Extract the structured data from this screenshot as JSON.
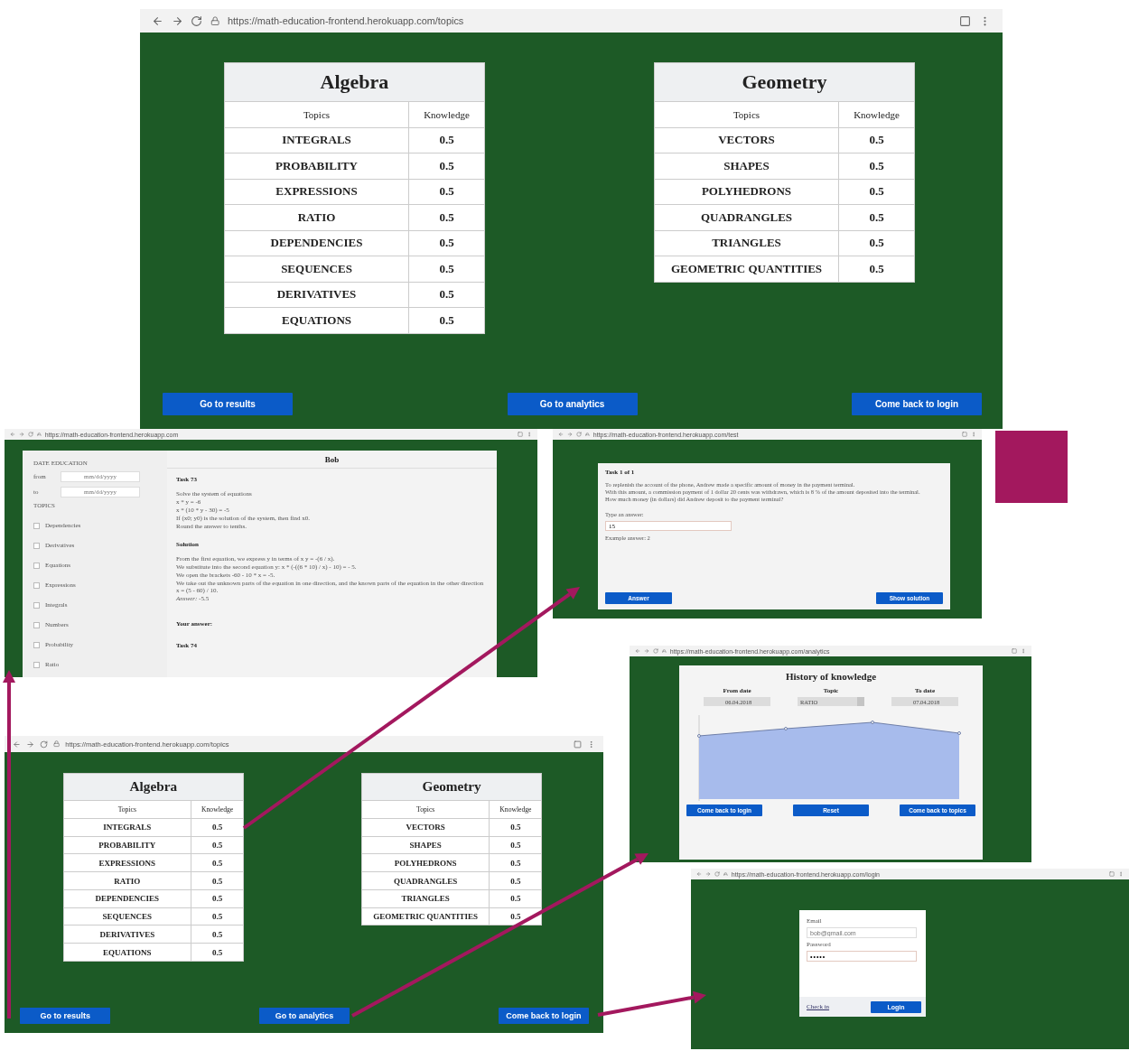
{
  "topics_page": {
    "url": "https://math-education-frontend.herokuapp.com/topics",
    "tables": [
      {
        "title": "Algebra",
        "columns": [
          "Topics",
          "Knowledge"
        ],
        "rows": [
          [
            "INTEGRALS",
            "0.5"
          ],
          [
            "PROBABILITY",
            "0.5"
          ],
          [
            "EXPRESSIONS",
            "0.5"
          ],
          [
            "RATIO",
            "0.5"
          ],
          [
            "DEPENDENCIES",
            "0.5"
          ],
          [
            "SEQUENCES",
            "0.5"
          ],
          [
            "DERIVATIVES",
            "0.5"
          ],
          [
            "EQUATIONS",
            "0.5"
          ]
        ]
      },
      {
        "title": "Geometry",
        "columns": [
          "Topics",
          "Knowledge"
        ],
        "rows": [
          [
            "VECTORS",
            "0.5"
          ],
          [
            "SHAPES",
            "0.5"
          ],
          [
            "POLYHEDRONS",
            "0.5"
          ],
          [
            "QUADRANGLES",
            "0.5"
          ],
          [
            "TRIANGLES",
            "0.5"
          ],
          [
            "GEOMETRIC QUANTITIES",
            "0.5"
          ]
        ]
      }
    ],
    "buttons": [
      "Go to results",
      "Go to analytics",
      "Come back to login"
    ]
  },
  "results_page": {
    "url": "https://math-education-frontend.herokuapp.com",
    "date_heading": "DATE EDUCATION",
    "date_fields": [
      {
        "label": "from",
        "placeholder": "mm/dd/yyyy"
      },
      {
        "label": "to",
        "placeholder": "mm/dd/yyyy"
      }
    ],
    "topics_heading": "TOPICS",
    "topics": [
      {
        "label": "Dependencies",
        "checked": false
      },
      {
        "label": "Derivatives",
        "checked": false
      },
      {
        "label": "Equations",
        "checked": false
      },
      {
        "label": "Expressions",
        "checked": false
      },
      {
        "label": "Integrals",
        "checked": false
      },
      {
        "label": "Numbers",
        "checked": false
      },
      {
        "label": "Probability",
        "checked": false
      },
      {
        "label": "Ratio",
        "checked": false
      }
    ],
    "user": "Bob",
    "task_title": "Task 73",
    "task_lines": [
      "Solve the system of equations",
      "x * y = -6",
      "x * (10 * y - 30) = -5",
      "If (x0; y0) is the solution of the system, then find x0.",
      "Round the answer to tenths."
    ],
    "solution_heading": "Solution",
    "solution_lines": [
      "From the first equation, we express y in terms of x y = -(6 / x).",
      "We substitute into the second equation y: x * (-((6 * 10) / x) - 10) = - 5.",
      "We open the brackets -60 - 10 * x = -5.",
      "We take out the unknown parts of the equation in one direction, and the known parts of the equation in the other direction x = (5 - 60) / 10.",
      "*Answer:* -5.5"
    ],
    "your_answer": "Your answer:",
    "next_task": "Task 74"
  },
  "task_page": {
    "url": "https://math-education-frontend.herokuapp.com/test",
    "title": "Task 1 of 1",
    "lines": [
      "To replenish the account of the phone, Andrew made a specific amount of money in the payment terminal.",
      "With this amount, a commission payment of 1 dollar 20 cents was withdrawn, which is 8 % of the amount deposited into the terminal.",
      "How much money (in dollars) did Andrew deposit to the payment terminal?"
    ],
    "answer_label": "Type an answer:",
    "answer_value": "15",
    "example": "Example answer: 2",
    "buttons": [
      "Answer",
      "Show solution"
    ]
  },
  "analytics_page": {
    "url": "https://math-education-frontend.herokuapp.com/analytics",
    "title": "History of knowledge",
    "filters": [
      {
        "label": "From date",
        "value": "06.04.2018",
        "kind": "date"
      },
      {
        "label": "Topic",
        "value": "RATIO",
        "kind": "select"
      },
      {
        "label": "To date",
        "value": "07.04.2018",
        "kind": "date"
      }
    ],
    "buttons": [
      "Come back to login",
      "Reset",
      "Come back to topics"
    ]
  },
  "topics_page_small": {
    "url": "https://math-education-frontend.herokuapp.com/topics",
    "tables": [
      {
        "title": "Algebra",
        "columns": [
          "Topics",
          "Knowledge"
        ],
        "rows": [
          [
            "INTEGRALS",
            "0.5"
          ],
          [
            "PROBABILITY",
            "0.5"
          ],
          [
            "EXPRESSIONS",
            "0.5"
          ],
          [
            "RATIO",
            "0.5"
          ],
          [
            "DEPENDENCIES",
            "0.5"
          ],
          [
            "SEQUENCES",
            "0.5"
          ],
          [
            "DERIVATIVES",
            "0.5"
          ],
          [
            "EQUATIONS",
            "0.5"
          ]
        ]
      },
      {
        "title": "Geometry",
        "columns": [
          "Topics",
          "Knowledge"
        ],
        "rows": [
          [
            "VECTORS",
            "0.5"
          ],
          [
            "SHAPES",
            "0.5"
          ],
          [
            "POLYHEDRONS",
            "0.5"
          ],
          [
            "QUADRANGLES",
            "0.5"
          ],
          [
            "TRIANGLES",
            "0.5"
          ],
          [
            "GEOMETRIC QUANTITIES",
            "0.5"
          ]
        ]
      }
    ],
    "buttons": [
      "Go to results",
      "Go to analytics",
      "Come back to login"
    ]
  },
  "login_page": {
    "url": "https://math-education-frontend.herokuapp.com/login",
    "fields": [
      {
        "label": "Email",
        "placeholder": "bob@gmail.com",
        "kind": "text"
      },
      {
        "label": "Password",
        "value": "•••••",
        "kind": "password"
      }
    ],
    "link": "Check in",
    "button": "Login"
  }
}
